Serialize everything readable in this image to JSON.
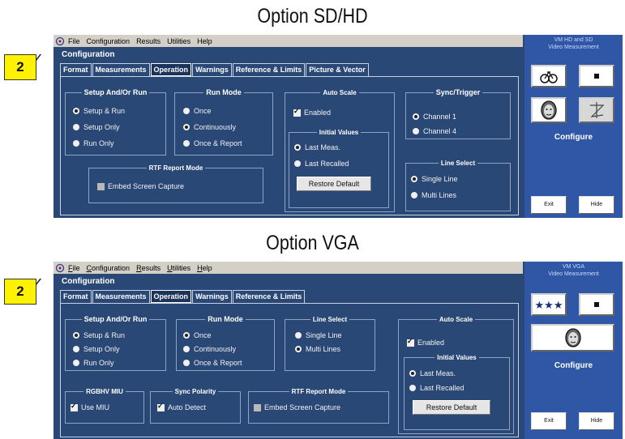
{
  "top": {
    "heading": "Option SD/HD",
    "callout": "2",
    "menu": [
      "File",
      "Configuration",
      "Results",
      "Utilities",
      "Help"
    ],
    "config_title": "Configuration",
    "tabs": [
      "Format",
      "Measurements",
      "Operation",
      "Warnings",
      "Reference & Limits",
      "Picture & Vector"
    ],
    "active_tab": "Operation",
    "setup_run": {
      "title": "Setup And/Or Run",
      "options": [
        "Setup & Run",
        "Setup Only",
        "Run Only"
      ],
      "selected": "Setup & Run"
    },
    "run_mode": {
      "title": "Run Mode",
      "options": [
        "Once",
        "Continuously",
        "Once & Report"
      ],
      "selected": "Continuously"
    },
    "auto_scale": {
      "title": "Auto Scale",
      "enabled_label": "Enabled",
      "enabled": true,
      "initial_values_title": "Initial Values",
      "options": [
        "Last Meas.",
        "Last Recalled"
      ],
      "selected": "Last Meas.",
      "restore_label": "Restore Default"
    },
    "sync_trigger": {
      "title": "Sync/Trigger",
      "options": [
        "Channel 1",
        "Channel 4"
      ],
      "selected": "Channel 1"
    },
    "line_select": {
      "title": "Line Select",
      "options": [
        "Single Line",
        "Multi Lines"
      ],
      "selected": "Single Line"
    },
    "rtf": {
      "title": "RTF Report Mode",
      "embed_label": "Embed Screen Capture"
    },
    "side": {
      "title_line1": "VM HD and SD",
      "title_line2": "Video Measurement",
      "configure": "Configure",
      "exit": "Exit",
      "hide": "Hide"
    }
  },
  "bottom": {
    "heading": "Option VGA",
    "callout": "2",
    "menu": [
      "File",
      "Configuration",
      "Results",
      "Utilities",
      "Help"
    ],
    "config_title": "Configuration",
    "tabs": [
      "Format",
      "Measurements",
      "Operation",
      "Warnings",
      "Reference & Limits"
    ],
    "active_tab": "Operation",
    "setup_run": {
      "title": "Setup And/Or Run",
      "options": [
        "Setup & Run",
        "Setup Only",
        "Run Only"
      ],
      "selected": "Setup & Run"
    },
    "run_mode": {
      "title": "Run Mode",
      "options": [
        "Once",
        "Continuously",
        "Once & Report"
      ],
      "selected": "Once"
    },
    "line_select": {
      "title": "Line Select",
      "options": [
        "Single Line",
        "Multi Lines"
      ],
      "selected": "Multi Lines"
    },
    "auto_scale": {
      "title": "Auto Scale",
      "enabled_label": "Enabled",
      "enabled": true,
      "initial_values_title": "Initial Values",
      "options": [
        "Last Meas.",
        "Last Recalled"
      ],
      "selected": "Last Meas.",
      "restore_label": "Restore Default"
    },
    "rgbhv": {
      "title": "RGBHV MIU",
      "use_label": "Use MIU",
      "checked": true
    },
    "sync_polarity": {
      "title": "Sync Polarity",
      "auto_label": "Auto Detect",
      "checked": true
    },
    "rtf": {
      "title": "RTF Report Mode",
      "embed_label": "Embed Screen Capture"
    },
    "side": {
      "title_line1": "VM VGA",
      "title_line2": "Video Measurement",
      "configure": "Configure",
      "exit": "Exit",
      "hide": "Hide"
    }
  },
  "colors": {
    "panel": "#2a4876",
    "side_panel": "#2f57a6",
    "callout": "#fff200"
  }
}
